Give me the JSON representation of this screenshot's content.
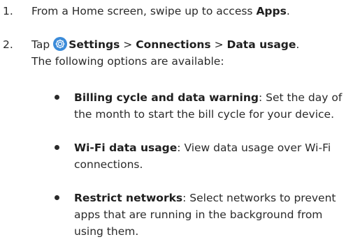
{
  "steps": [
    {
      "number": "1.",
      "prefix": "From a Home screen, swipe up to access ",
      "bold": "Apps",
      "suffix": "."
    },
    {
      "number": "2.",
      "tap": "Tap",
      "settings": "Settings",
      "sep1": " > ",
      "connections": "Connections",
      "sep2": " > ",
      "data_usage": "Data usage",
      "end": ".",
      "line2": "The following options are available:"
    }
  ],
  "options": [
    {
      "title": "Billing cycle and data warning",
      "desc": ": Set the day of the month to start the bill cycle for your device."
    },
    {
      "title": "Wi-Fi data usage",
      "desc": ": View data usage over Wi-Fi connections."
    },
    {
      "title": "Restrict networks",
      "desc": ": Select networks to prevent apps that are running in the background from using them."
    }
  ],
  "icon": {
    "name": "settings-gear-icon",
    "color": "#3b8bd9"
  }
}
